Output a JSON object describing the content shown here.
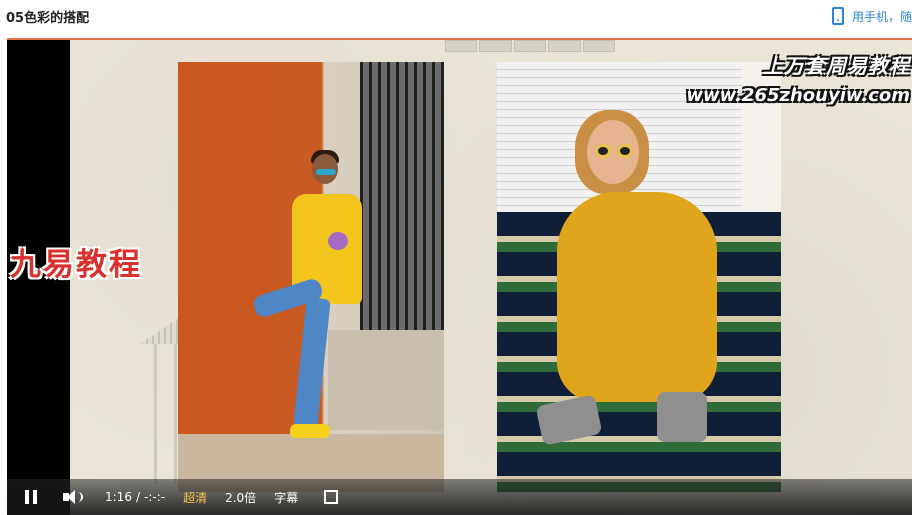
{
  "page": {
    "title": "05色彩的搭配",
    "mobile_link": "用手机，随"
  },
  "slide": {
    "watermark_line1": "上万套周易教程",
    "watermark_line2": "www.265zhouyiw.com",
    "left_label": "九易教程"
  },
  "controls": {
    "current_time": "1:16",
    "separator": "/",
    "duration": "-:-:-",
    "quality": "超清",
    "speed": "2.0倍",
    "subtitle": "字幕"
  },
  "colors": {
    "accent_blue": "#2b86d8",
    "quality_gold": "#f3c14e",
    "label_red": "#d9322e"
  },
  "icons": [
    "phone-icon",
    "pause-icon",
    "volume-icon",
    "fullscreen-icon"
  ]
}
